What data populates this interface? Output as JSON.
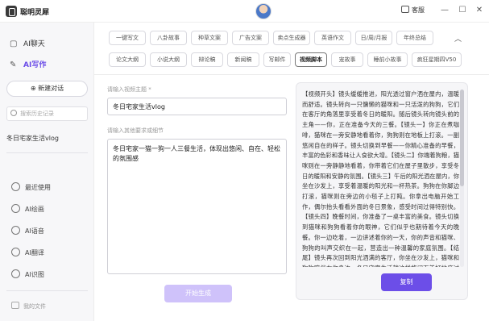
{
  "app": {
    "title": "聪明灵犀"
  },
  "titlebar": {
    "service_label": "客服"
  },
  "sidebar": {
    "nav": [
      {
        "label": "AI聊天",
        "icon": "chat-icon"
      },
      {
        "label": "AI写作",
        "icon": "pen-icon"
      }
    ],
    "new_chat_label": "新建对话",
    "search_placeholder": "搜索历史记录",
    "history": [
      "冬日宅家生活vlog"
    ],
    "tools": [
      {
        "label": "最近使用",
        "icon": "clock-icon"
      },
      {
        "label": "AI绘画",
        "icon": "paint-icon"
      },
      {
        "label": "AI语音",
        "icon": "headset-icon"
      },
      {
        "label": "AI翻译",
        "icon": "translate-icon"
      },
      {
        "label": "AI识图",
        "icon": "image-icon"
      }
    ],
    "files_label": "我的文件"
  },
  "tags": {
    "row1": [
      "一键写文",
      "八卦故事",
      "种草文案",
      "广告文案",
      "卖点生成器",
      "英语作文",
      "日/周/月报",
      "年终总结"
    ],
    "row2": [
      "论文大纲",
      "小说大纲",
      "辩论稿",
      "新闻稿",
      "写邮件",
      "视频脚本",
      "宠故事",
      "睡前小故事",
      "疯狂星期四V50"
    ],
    "active": "视频脚本"
  },
  "form": {
    "topic_label": "请输入视频主题 *",
    "topic_value": "冬日宅家生活vlog",
    "details_label": "请输入其他要求或细节",
    "details_value": "冬日宅家一猫一狗一人三餐生活，体现出悠闲、自在、轻松的氛围感",
    "generate_label": "开始生成"
  },
  "output": {
    "text": "【视频开头】镜头缓缓推进，阳光透过窗户洒在屋内，温暖而舒适。镜头转向一只慵懒的猫咪和一只活泼的狗狗，它们在客厅的角落里享受着冬日的暖阳。随后镜头转向镜头前的主角——你，正在准备今天的三餐。【镜头一】你正在煮咖啡，猫咪在一旁安静地看着你，狗狗则在地板上打滚。一副悠闲自在的样子。镜头切换到早餐——你精心准备的早餐，丰富的色彩和香味让人食欲大增。【镜头二】你端着狗粮，猫咪则在一旁静静地看着，你带着它们在屋子里散步，享受冬日的暖阳和安静的氛围。【镜头三】午后的阳光洒在屋内，你坐在沙发上，享受着温暖的阳光和一杯热茶。狗狗在你脚边打滚，猫咪则在旁边的小毯子上打盹。你拿出电脑开始工作，偶尔抬头看看外面的冬日景象，感受时间过得特别快。【镜头四】晚餐时间，你准备了一桌丰富的美食。镜头切换到猫咪和狗狗看着你的眼神，它们似乎也期待着今天的晚餐。你一边吃着，一边讲述着你的一天，你的声音和猫咪、狗狗的叫声交织在一起，营造出一种温馨的家庭氛围。【结尾】镜头再次回到阳光洒满的客厅，你坐在沙发上，猫咪和狗狗陪伴在你身边，冬日宅家生活就这样悠闲而美好地度过了。",
    "copy_label": "复制"
  },
  "colors": {
    "accent": "#6c4ee8",
    "accent_light": "#cfc2fa"
  }
}
